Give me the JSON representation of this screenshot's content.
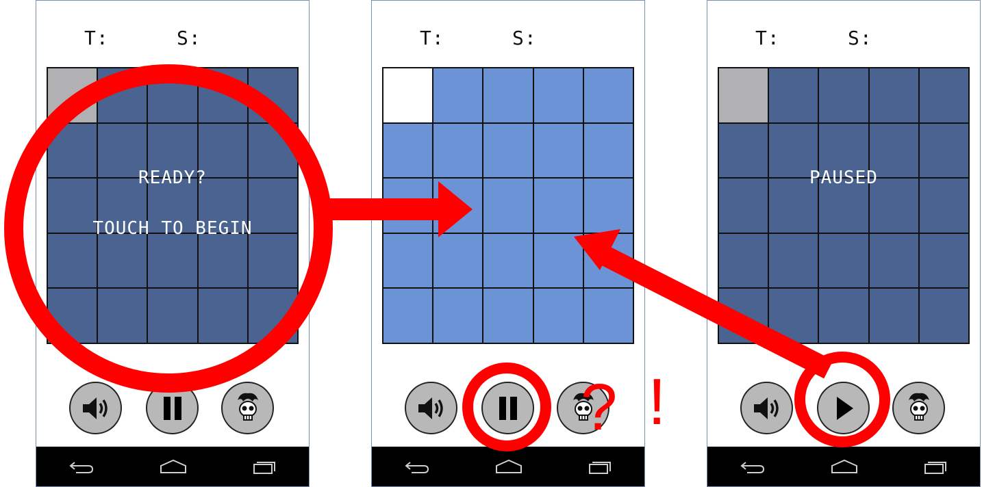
{
  "colors": {
    "grid_idle": "#4a6391",
    "grid_active": "#6b93d6",
    "selected_cell_idle": "#b1b0b3",
    "selected_cell_active": "#ffffff",
    "annotation": "#ff0000"
  },
  "icons": {
    "sound": "speaker-icon",
    "pause": "pause-icon",
    "play": "play-icon",
    "logo": "skull-icon",
    "back": "back-icon",
    "home": "home-icon",
    "recents": "recent-apps-icon"
  },
  "screens": [
    {
      "state": "ready",
      "header": {
        "time_label": "T:",
        "score_label": "S:"
      },
      "message_lines": [
        "READY?",
        "TOUCH TO BEGIN"
      ],
      "grid": {
        "rows": 5,
        "cols": 5,
        "active": false,
        "highlight_cell": [
          0,
          0
        ]
      },
      "controls": {
        "toggle_icon": "pause-icon"
      }
    },
    {
      "state": "playing",
      "header": {
        "time_label": "T:",
        "score_label": "S:"
      },
      "message_lines": [],
      "grid": {
        "rows": 5,
        "cols": 5,
        "active": true,
        "highlight_cell": [
          0,
          0
        ]
      },
      "controls": {
        "toggle_icon": "pause-icon"
      }
    },
    {
      "state": "paused",
      "header": {
        "time_label": "T:",
        "score_label": "S:"
      },
      "message_lines": [
        "PAUSED"
      ],
      "grid": {
        "rows": 5,
        "cols": 5,
        "active": false,
        "highlight_cell": [
          0,
          0
        ]
      },
      "controls": {
        "toggle_icon": "play-icon"
      }
    }
  ],
  "annotations": {
    "question": "?",
    "exclaim": "!"
  }
}
